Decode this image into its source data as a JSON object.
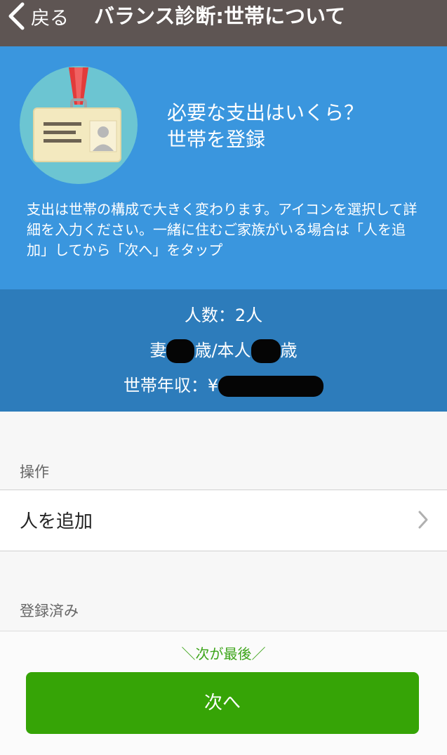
{
  "navbar": {
    "back_label": "戻る",
    "title": "バランス診断:世帯について"
  },
  "hero": {
    "icon": "id-card-icon",
    "heading_line1": "必要な支出はいくら？",
    "heading_line2": "世帯を登録",
    "description": "支出は世帯の構成で大きく変わります。アイコンを選択して詳細を入力ください。一緒に住むご家族がいる場合は「人を追加」してから「次へ」をタップ"
  },
  "summary": {
    "people_count": "人数：2人",
    "wife_prefix": "妻",
    "age_unit": "歳",
    "self_prefix": "/本人",
    "income_prefix": "世帯年収：¥"
  },
  "sections": {
    "operations_header": "操作",
    "add_person_label": "人を追加",
    "registered_header": "登録済み"
  },
  "footer": {
    "hint": "＼次が最後／",
    "next_label": "次へ"
  },
  "colors": {
    "navbar": "#5e5553",
    "hero": "#3a96de",
    "summary": "#2d7cbb",
    "accent_green": "#36a406"
  }
}
